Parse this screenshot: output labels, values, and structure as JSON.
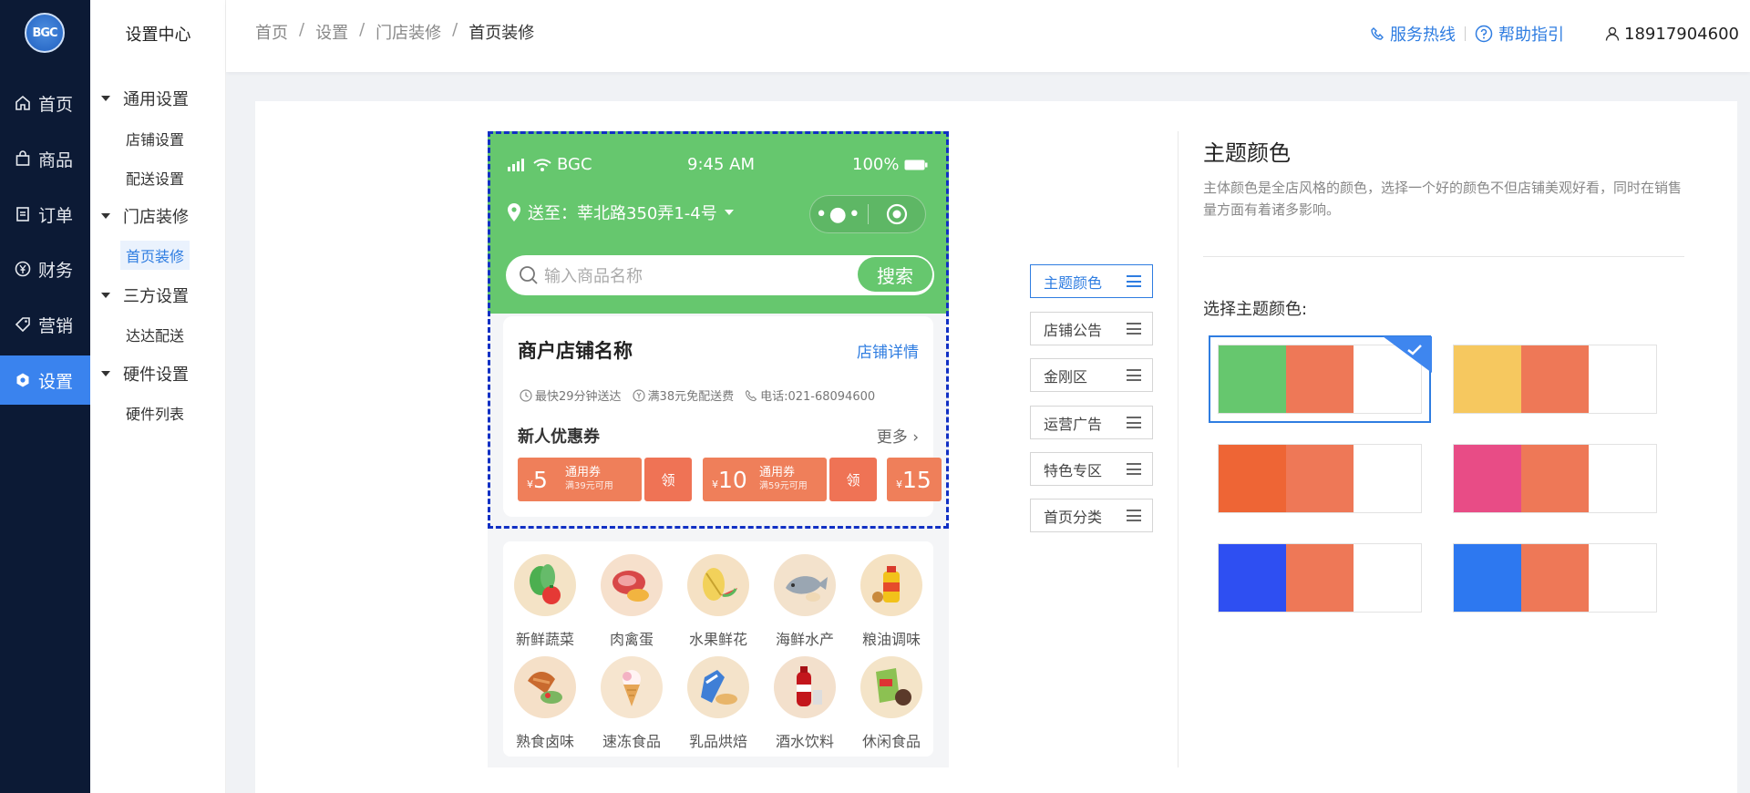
{
  "nav": {
    "logo": "BGC",
    "items": [
      {
        "label": "首页",
        "icon": "home-icon"
      },
      {
        "label": "商品",
        "icon": "bag-icon"
      },
      {
        "label": "订单",
        "icon": "order-icon"
      },
      {
        "label": "财务",
        "icon": "yen-icon"
      },
      {
        "label": "营销",
        "icon": "tag-icon"
      },
      {
        "label": "设置",
        "icon": "settings-icon",
        "active": true
      }
    ]
  },
  "submenu": {
    "title": "设置中心",
    "groups": [
      {
        "label": "通用设置",
        "items": [
          "店铺设置",
          "配送设置"
        ]
      },
      {
        "label": "门店装修",
        "items": [
          "首页装修"
        ]
      },
      {
        "label": "三方设置",
        "items": [
          "达达配送"
        ]
      },
      {
        "label": "硬件设置",
        "items": [
          "硬件列表"
        ]
      }
    ]
  },
  "header": {
    "breadcrumb": [
      "首页",
      "设置",
      "门店装修",
      "首页装修"
    ],
    "hotline": "服务热线",
    "help": "帮助指引",
    "user": "18917904600"
  },
  "phone": {
    "carrier": "BGC",
    "time": "9:45 AM",
    "battery": "100%",
    "address": "送至：莘北路350弄1-4号",
    "search_placeholder": "输入商品名称",
    "search_button": "搜索",
    "shop_name": "商户店铺名称",
    "shop_detail": "店铺详情",
    "meta": [
      "最快29分钟送达",
      "满38元免配送费",
      "电话:021-68094600"
    ],
    "coupon_title": "新人优惠券",
    "coupon_more": "更多",
    "coupons": [
      {
        "amount": "5",
        "type": "通用券",
        "cond": "满39元可用",
        "take": "领"
      },
      {
        "amount": "10",
        "type": "通用券",
        "cond": "满59元可用",
        "take": "领"
      },
      {
        "amount": "15"
      }
    ],
    "categories": [
      {
        "label": "新鲜蔬菜",
        "color": "#f4e3c6"
      },
      {
        "label": "肉禽蛋",
        "color": "#f6e0cc"
      },
      {
        "label": "水果鲜花",
        "color": "#f5e1c4"
      },
      {
        "label": "海鲜水产",
        "color": "#f3e2cc"
      },
      {
        "label": "粮油调味",
        "color": "#f5e2c2"
      },
      {
        "label": "熟食卤味",
        "color": "#f5e0c8"
      },
      {
        "label": "速冻食品",
        "color": "#f6e5cf"
      },
      {
        "label": "乳品烘焙",
        "color": "#f4e3ca"
      },
      {
        "label": "酒水饮料",
        "color": "#f3e0cc"
      },
      {
        "label": "休闲食品",
        "color": "#f4e4c8"
      }
    ]
  },
  "sections": [
    "主题颜色",
    "店铺公告",
    "金刚区",
    "运营广告",
    "特色专区",
    "首页分类"
  ],
  "theme": {
    "title": "主题颜色",
    "desc": "主体颜色是全店风格的颜色，选择一个好的颜色不但店铺美观好看，同时在销售量方面有着诸多影响。",
    "choose_label": "选择主题颜色:",
    "swatches": [
      {
        "primary": "#66c76e",
        "secondary": "#ee7857",
        "selected": true
      },
      {
        "primary": "#f6c85f",
        "secondary": "#ee7857"
      },
      {
        "primary": "#ee6535",
        "secondary": "#ee7857"
      },
      {
        "primary": "#e84c86",
        "secondary": "#ee7857"
      },
      {
        "primary": "#2e4ff2",
        "secondary": "#ee7857"
      },
      {
        "primary": "#2d78f0",
        "secondary": "#ee7857"
      }
    ]
  },
  "colors": {
    "accent": "#2f7de1",
    "nav_bg": "#0c1a35",
    "phone_green": "#66c76e"
  }
}
